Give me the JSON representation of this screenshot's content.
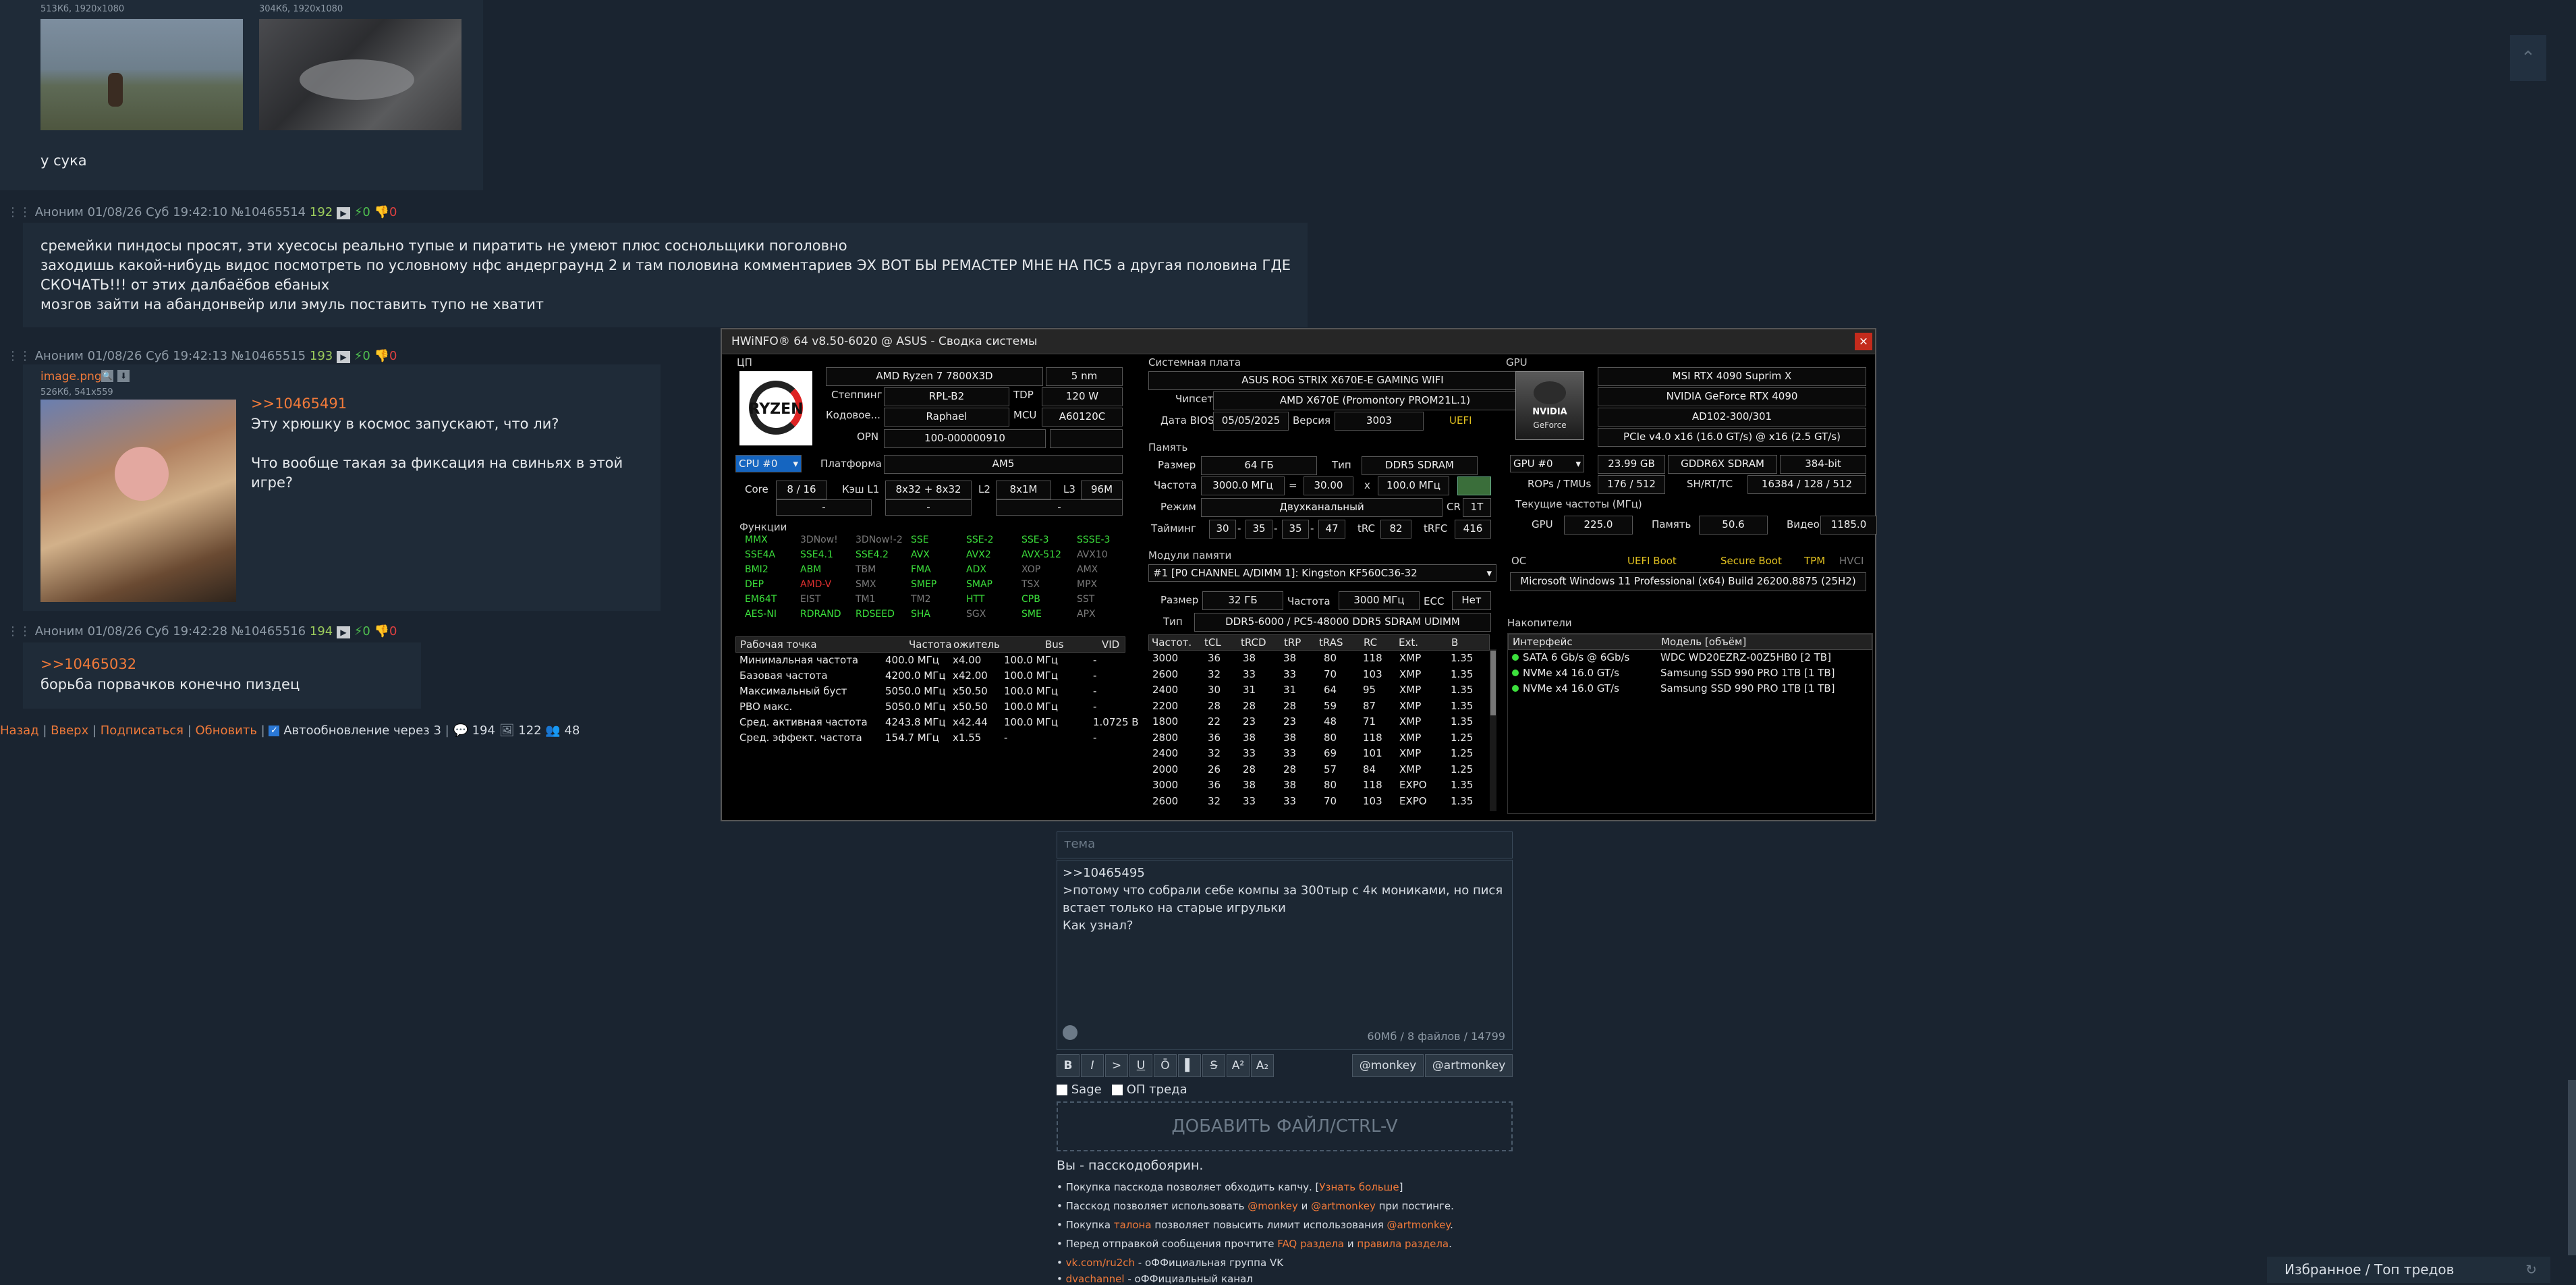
{
  "posts": [
    {
      "files": [
        {
          "info": "513Кб, 1920x1080"
        },
        {
          "info": "304Кб, 1920x1080"
        }
      ],
      "text": [
        "у сука"
      ]
    },
    {
      "author": "Аноним",
      "date": "01/08/26 Суб 19:42:10",
      "num": "№10465514",
      "count": "192",
      "likes": "0",
      "dislikes": "0",
      "text": [
        "сремейки пиндосы просят, эти хуесосы реально тупые и пиратить не умеют плюс соснольщики поголовно",
        "заходишь какой-нибудь видос посмотреть по условному нфс андерграунд 2 и там половина комментариев ЭХ ВОТ БЫ РЕМАСТЕР МНЕ НА ПС5 а другая половина ГДЕ",
        "СКОЧАТЬ!!! от этих далбаёбов ебаных",
        "мозгов зайти на абандонвейр или эмуль поставить тупо не хватит"
      ]
    },
    {
      "author": "Аноним",
      "date": "01/08/26 Суб 19:42:13",
      "num": "№10465515",
      "count": "193",
      "likes": "0",
      "dislikes": "0",
      "file_name": "image.png",
      "file_info": "526Кб, 541x559",
      "reply": ">>10465491",
      "text": [
        "Эту хрюшку в космос запускают, что ли?",
        "",
        "Что вообще такая за фиксация на свиньях в этой игре?"
      ]
    },
    {
      "author": "Аноним",
      "date": "01/08/26 Суб 19:42:28",
      "num": "№10465516",
      "count": "194",
      "likes": "0",
      "dislikes": "0",
      "reply": ">>10465032",
      "text": [
        "борьба порвачков конечно пиздец"
      ]
    }
  ],
  "nav": {
    "back": "Назад",
    "up": "Вверх",
    "subscribe": "Подписаться",
    "refresh": "Обновить",
    "auto": "Автообновление через 3",
    "posts": "194",
    "files": "122",
    "users": "48"
  },
  "hwinfo": {
    "title": "HWiNFO® 64 v8.50-6020 @ ASUS  - Сводка системы",
    "close": "×",
    "cpu": {
      "section": "ЦП",
      "name": "AMD Ryzen 7 7800X3D",
      "node": "5 nm",
      "stepping_label": "Степпинг",
      "stepping": "RPL-B2",
      "tdp_label": "TDP",
      "tdp": "120 W",
      "code_label": "Кодовое...",
      "code": "Raphael",
      "mcu_label": "MCU",
      "mcu": "A60120C",
      "opn_label": "OPN",
      "opn": "100-000000910",
      "selector": "CPU #0",
      "platform_label": "Платформа",
      "platform": "AM5",
      "core_label": "Core",
      "core": "8 / 16",
      "l1_label": "Кэш L1",
      "l1": "8x32 + 8x32",
      "l2_label": "L2",
      "l2": "8x1M",
      "l3_label": "L3",
      "l3": "96M",
      "dash1": "-",
      "dash2": "-",
      "dash3": "-",
      "features_label": "Функции",
      "features": [
        [
          "MMX",
          "on"
        ],
        [
          "3DNow!",
          "off"
        ],
        [
          "3DNow!-2",
          "off"
        ],
        [
          "SSE",
          "on"
        ],
        [
          "SSE-2",
          "on"
        ],
        [
          "SSE-3",
          "on"
        ],
        [
          "SSSE-3",
          "on"
        ],
        [
          "SSE4A",
          "on"
        ],
        [
          "SSE4.1",
          "on"
        ],
        [
          "SSE4.2",
          "on"
        ],
        [
          "AVX",
          "on"
        ],
        [
          "AVX2",
          "on"
        ],
        [
          "AVX-512",
          "on"
        ],
        [
          "AVX10",
          "off"
        ],
        [
          "BMI2",
          "on"
        ],
        [
          "ABM",
          "on"
        ],
        [
          "TBM",
          "off"
        ],
        [
          "FMA",
          "on"
        ],
        [
          "ADX",
          "on"
        ],
        [
          "XOP",
          "off"
        ],
        [
          "AMX",
          "off"
        ],
        [
          "DEP",
          "on"
        ],
        [
          "AMD-V",
          "red"
        ],
        [
          "SMX",
          "off"
        ],
        [
          "SMEP",
          "on"
        ],
        [
          "SMAP",
          "on"
        ],
        [
          "TSX",
          "off"
        ],
        [
          "MPX",
          "off"
        ],
        [
          "EM64T",
          "on"
        ],
        [
          "EIST",
          "off"
        ],
        [
          "TM1",
          "off"
        ],
        [
          "TM2",
          "off"
        ],
        [
          "HTT",
          "on"
        ],
        [
          "CPB",
          "on"
        ],
        [
          "SST",
          "off"
        ],
        [
          "AES-NI",
          "on"
        ],
        [
          "RDRAND",
          "on"
        ],
        [
          "RDSEED",
          "on"
        ],
        [
          "SHA",
          "on"
        ],
        [
          "SGX",
          "off"
        ],
        [
          "SME",
          "on"
        ],
        [
          "APX",
          "off"
        ]
      ],
      "op_headers": [
        "Рабочая точка",
        "Частота",
        "ожитель",
        "Bus",
        "VID"
      ],
      "op_rows": [
        [
          "Минимальная частота",
          "400.0 МГц",
          "x4.00",
          "100.0 МГц",
          "-"
        ],
        [
          "Базовая частота",
          "4200.0 МГц",
          "x42.00",
          "100.0 МГц",
          "-"
        ],
        [
          "Максимальный буст",
          "5050.0 МГц",
          "x50.50",
          "100.0 МГц",
          "-"
        ],
        [
          "PBO макс.",
          "5050.0 МГц",
          "x50.50",
          "100.0 МГц",
          "-"
        ],
        [
          "Сред. активная частота",
          "4243.8 МГц",
          "x42.44",
          "100.0 МГц",
          "1.0725 В"
        ],
        [
          "Сред. эффект. частота",
          "154.7 МГц",
          "x1.55",
          "-",
          "-"
        ]
      ]
    },
    "mb": {
      "section": "Системная плата",
      "name": "ASUS ROG STRIX X670E-E GAMING WIFI",
      "chipset_label": "Чипсет",
      "chipset": "AMD X670E (Promontory PROM21L.1)",
      "bios_label": "Дата BIOS",
      "bios_date": "05/05/2025",
      "version_label": "Версия",
      "version": "3003",
      "uefi": "UEFI"
    },
    "mem": {
      "section": "Память",
      "size_label": "Размер",
      "size": "64 ГБ",
      "type_label": "Тип",
      "type": "DDR5 SDRAM",
      "freq_label": "Частота",
      "freq": "3000.0 МГц",
      "eq": "=",
      "mult": "30.00",
      "x": "x",
      "bus": "100.0 МГц",
      "mode_label": "Режим",
      "mode": "Двухканальный",
      "cr_label": "CR",
      "cr": "1T",
      "timing_label": "Тайминг",
      "timings": [
        "30",
        "35",
        "35",
        "47"
      ],
      "trc_label": "tRC",
      "trc": "82",
      "trfc_label": "tRFC",
      "trfc": "416"
    },
    "modules": {
      "section": "Модули памяти",
      "selected": "#1 [P0 CHANNEL A/DIMM 1]: Kingston KF560C36-32",
      "size_label": "Размер",
      "size": "32 ГБ",
      "freq_label": "Частота",
      "freq": "3000 МГц",
      "ecc_label": "ECC",
      "ecc": "Нет",
      "type_label": "Тип",
      "type": "DDR5-6000 / PC5-48000 DDR5 SDRAM UDIMM",
      "headers": [
        "Частот.",
        "tCL",
        "tRCD",
        "tRP",
        "tRAS",
        "RC",
        "Ext.",
        "В"
      ],
      "rows": [
        [
          "3000",
          "36",
          "38",
          "38",
          "80",
          "118",
          "XMP",
          "1.35"
        ],
        [
          "2600",
          "32",
          "33",
          "33",
          "70",
          "103",
          "XMP",
          "1.35"
        ],
        [
          "2400",
          "30",
          "31",
          "31",
          "64",
          "95",
          "XMP",
          "1.35"
        ],
        [
          "2200",
          "28",
          "28",
          "28",
          "59",
          "87",
          "XMP",
          "1.35"
        ],
        [
          "1800",
          "22",
          "23",
          "23",
          "48",
          "71",
          "XMP",
          "1.35"
        ],
        [
          "2800",
          "36",
          "38",
          "38",
          "80",
          "118",
          "XMP",
          "1.25"
        ],
        [
          "2400",
          "32",
          "33",
          "33",
          "69",
          "101",
          "XMP",
          "1.25"
        ],
        [
          "2000",
          "26",
          "28",
          "28",
          "57",
          "84",
          "XMP",
          "1.25"
        ],
        [
          "3000",
          "36",
          "38",
          "38",
          "80",
          "118",
          "EXPO",
          "1.35"
        ],
        [
          "2600",
          "32",
          "33",
          "33",
          "70",
          "103",
          "EXPO",
          "1.35"
        ]
      ]
    },
    "gpu": {
      "section": "GPU",
      "name": "MSI RTX 4090 Suprim X",
      "chip_name": "NVIDIA GeForce RTX 4090",
      "chip": "AD102-300/301",
      "pcie": "PCIe v4.0 x16 (16.0 GT/s) @ x16 (2.5 GT/s)",
      "selector": "GPU #0",
      "vram": "23.99 GB",
      "vram_type": "GDDR6X SDRAM",
      "bus_width": "384-bit",
      "rops_label": "ROPs / TMUs",
      "rops": "176 / 512",
      "sh_label": "SH/RT/TC",
      "sh": "16384 / 128 / 512",
      "clocks_label": "Текущие частоты (МГц)",
      "gpu_label": "GPU",
      "gpu_clock": "225.0",
      "mem_label": "Память",
      "mem_clock": "50.6",
      "video_label": "Видео",
      "video_clock": "1185.0"
    },
    "os": {
      "section": "ОС",
      "uefi": "UEFI Boot",
      "secure": "Secure Boot",
      "tpm": "TPM",
      "hvci": "HVCI",
      "name": "Microsoft Windows 11 Professional (x64) Build 26200.8875 (25H2)"
    },
    "drives": {
      "section": "Накопители",
      "headers": [
        "Интерфейс",
        "Модель [объём]"
      ],
      "rows": [
        [
          "SATA 6 Gb/s @ 6Gb/s",
          "WDC WD20EZRZ-00Z5HB0 [2 TB]"
        ],
        [
          "NVMe x4 16.0 GT/s",
          "Samsung SSD 990 PRO 1TB [1 TB]"
        ],
        [
          "NVMe x4 16.0 GT/s",
          "Samsung SSD 990 PRO 1TB [1 TB]"
        ]
      ]
    }
  },
  "form": {
    "theme_placeholder": "тема",
    "message": [
      ">>10465495",
      ">потому что собрали себе компы за 300тыр с 4к мониками, но пися",
      "встает только на старые игрульки",
      "Как узнал?"
    ],
    "counter": "60Мб / 8 файлов / 14799",
    "fmt_buttons": [
      "B",
      "I",
      ">",
      "U",
      "Ō",
      "▌",
      "S",
      "A²",
      "A₂"
    ],
    "monkey": "@monkey",
    "artmonkey": "@artmonkey",
    "sage": "Sage",
    "op": "ОП треда",
    "add_file": "ДОБАВИТЬ ФАЙЛ/CTRL-V",
    "status": "Вы - пасскодобоярин.",
    "info": [
      [
        "• Покупка пасскода позволяет обходить капчу. [",
        "Узнать больше",
        "]"
      ],
      [
        "• Пасскод позволяет использовать ",
        "@monkey",
        " и ",
        "@artmonkey",
        " при постинге."
      ],
      [
        "• Покупка ",
        "талона",
        " позволяет повысить лимит использования ",
        "@artmonkey",
        "."
      ],
      [
        "• Перед отправкой сообщения прочтите ",
        "FAQ раздела",
        " и ",
        "правила раздела",
        "."
      ],
      [
        "• ",
        "vk.com/ru2ch",
        " - оФФициальная группа VK"
      ],
      [
        "• ",
        "dvachannel",
        " - оФФициальный канал"
      ]
    ]
  },
  "bottom_bar": {
    "label": "Избранное / Топ тредов"
  },
  "colors": {
    "bg": "#1a2430",
    "post_bg": "#1f2b38",
    "accent": "#f07a3a",
    "green_feature": "#3ce03c"
  }
}
